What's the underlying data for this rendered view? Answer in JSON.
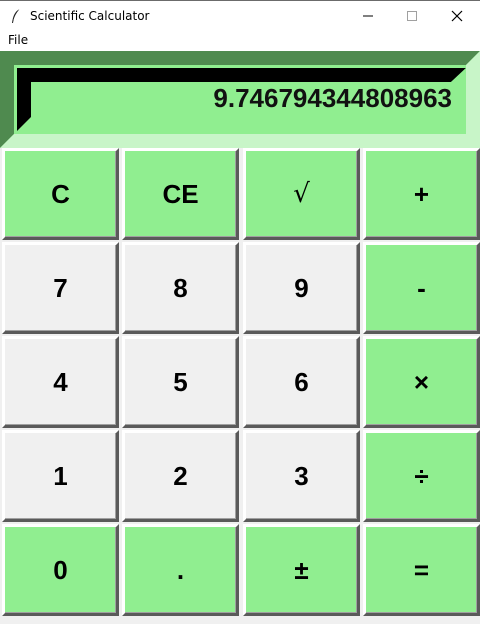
{
  "window": {
    "title": "Scientific Calculator",
    "icon": "feather-icon",
    "controls": [
      "minimize-icon",
      "maximize-icon",
      "close-icon"
    ]
  },
  "menu": {
    "file_label": "File"
  },
  "display": {
    "value": "9.746794344808963"
  },
  "keys": {
    "clear": "C",
    "clear_entry": "CE",
    "sqrt": "√",
    "add": "+",
    "seven": "7",
    "eight": "8",
    "nine": "9",
    "subtract": "-",
    "four": "4",
    "five": "5",
    "six": "6",
    "multiply": "×",
    "one": "1",
    "two": "2",
    "three": "3",
    "divide": "÷",
    "zero": "0",
    "decimal": ".",
    "negate": "±",
    "equals": "="
  },
  "colors": {
    "accent_green": "#90ee90",
    "display_shadow": "#4f8a4f",
    "display_dark": "#000000",
    "key_gray": "#f0f0f0"
  }
}
